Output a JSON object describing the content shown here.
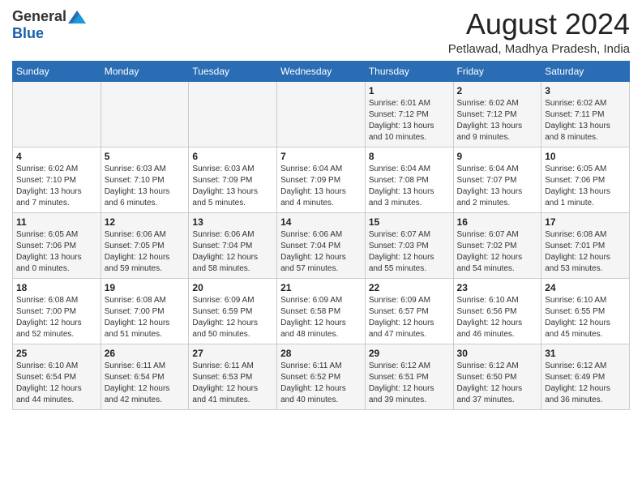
{
  "header": {
    "logo_general": "General",
    "logo_blue": "Blue",
    "title": "August 2024",
    "subtitle": "Petlawad, Madhya Pradesh, India"
  },
  "weekdays": [
    "Sunday",
    "Monday",
    "Tuesday",
    "Wednesday",
    "Thursday",
    "Friday",
    "Saturday"
  ],
  "weeks": [
    [
      {
        "day": "",
        "content": ""
      },
      {
        "day": "",
        "content": ""
      },
      {
        "day": "",
        "content": ""
      },
      {
        "day": "",
        "content": ""
      },
      {
        "day": "1",
        "content": "Sunrise: 6:01 AM\nSunset: 7:12 PM\nDaylight: 13 hours\nand 10 minutes."
      },
      {
        "day": "2",
        "content": "Sunrise: 6:02 AM\nSunset: 7:12 PM\nDaylight: 13 hours\nand 9 minutes."
      },
      {
        "day": "3",
        "content": "Sunrise: 6:02 AM\nSunset: 7:11 PM\nDaylight: 13 hours\nand 8 minutes."
      }
    ],
    [
      {
        "day": "4",
        "content": "Sunrise: 6:02 AM\nSunset: 7:10 PM\nDaylight: 13 hours\nand 7 minutes."
      },
      {
        "day": "5",
        "content": "Sunrise: 6:03 AM\nSunset: 7:10 PM\nDaylight: 13 hours\nand 6 minutes."
      },
      {
        "day": "6",
        "content": "Sunrise: 6:03 AM\nSunset: 7:09 PM\nDaylight: 13 hours\nand 5 minutes."
      },
      {
        "day": "7",
        "content": "Sunrise: 6:04 AM\nSunset: 7:09 PM\nDaylight: 13 hours\nand 4 minutes."
      },
      {
        "day": "8",
        "content": "Sunrise: 6:04 AM\nSunset: 7:08 PM\nDaylight: 13 hours\nand 3 minutes."
      },
      {
        "day": "9",
        "content": "Sunrise: 6:04 AM\nSunset: 7:07 PM\nDaylight: 13 hours\nand 2 minutes."
      },
      {
        "day": "10",
        "content": "Sunrise: 6:05 AM\nSunset: 7:06 PM\nDaylight: 13 hours\nand 1 minute."
      }
    ],
    [
      {
        "day": "11",
        "content": "Sunrise: 6:05 AM\nSunset: 7:06 PM\nDaylight: 13 hours\nand 0 minutes."
      },
      {
        "day": "12",
        "content": "Sunrise: 6:06 AM\nSunset: 7:05 PM\nDaylight: 12 hours\nand 59 minutes."
      },
      {
        "day": "13",
        "content": "Sunrise: 6:06 AM\nSunset: 7:04 PM\nDaylight: 12 hours\nand 58 minutes."
      },
      {
        "day": "14",
        "content": "Sunrise: 6:06 AM\nSunset: 7:04 PM\nDaylight: 12 hours\nand 57 minutes."
      },
      {
        "day": "15",
        "content": "Sunrise: 6:07 AM\nSunset: 7:03 PM\nDaylight: 12 hours\nand 55 minutes."
      },
      {
        "day": "16",
        "content": "Sunrise: 6:07 AM\nSunset: 7:02 PM\nDaylight: 12 hours\nand 54 minutes."
      },
      {
        "day": "17",
        "content": "Sunrise: 6:08 AM\nSunset: 7:01 PM\nDaylight: 12 hours\nand 53 minutes."
      }
    ],
    [
      {
        "day": "18",
        "content": "Sunrise: 6:08 AM\nSunset: 7:00 PM\nDaylight: 12 hours\nand 52 minutes."
      },
      {
        "day": "19",
        "content": "Sunrise: 6:08 AM\nSunset: 7:00 PM\nDaylight: 12 hours\nand 51 minutes."
      },
      {
        "day": "20",
        "content": "Sunrise: 6:09 AM\nSunset: 6:59 PM\nDaylight: 12 hours\nand 50 minutes."
      },
      {
        "day": "21",
        "content": "Sunrise: 6:09 AM\nSunset: 6:58 PM\nDaylight: 12 hours\nand 48 minutes."
      },
      {
        "day": "22",
        "content": "Sunrise: 6:09 AM\nSunset: 6:57 PM\nDaylight: 12 hours\nand 47 minutes."
      },
      {
        "day": "23",
        "content": "Sunrise: 6:10 AM\nSunset: 6:56 PM\nDaylight: 12 hours\nand 46 minutes."
      },
      {
        "day": "24",
        "content": "Sunrise: 6:10 AM\nSunset: 6:55 PM\nDaylight: 12 hours\nand 45 minutes."
      }
    ],
    [
      {
        "day": "25",
        "content": "Sunrise: 6:10 AM\nSunset: 6:54 PM\nDaylight: 12 hours\nand 44 minutes."
      },
      {
        "day": "26",
        "content": "Sunrise: 6:11 AM\nSunset: 6:54 PM\nDaylight: 12 hours\nand 42 minutes."
      },
      {
        "day": "27",
        "content": "Sunrise: 6:11 AM\nSunset: 6:53 PM\nDaylight: 12 hours\nand 41 minutes."
      },
      {
        "day": "28",
        "content": "Sunrise: 6:11 AM\nSunset: 6:52 PM\nDaylight: 12 hours\nand 40 minutes."
      },
      {
        "day": "29",
        "content": "Sunrise: 6:12 AM\nSunset: 6:51 PM\nDaylight: 12 hours\nand 39 minutes."
      },
      {
        "day": "30",
        "content": "Sunrise: 6:12 AM\nSunset: 6:50 PM\nDaylight: 12 hours\nand 37 minutes."
      },
      {
        "day": "31",
        "content": "Sunrise: 6:12 AM\nSunset: 6:49 PM\nDaylight: 12 hours\nand 36 minutes."
      }
    ]
  ]
}
